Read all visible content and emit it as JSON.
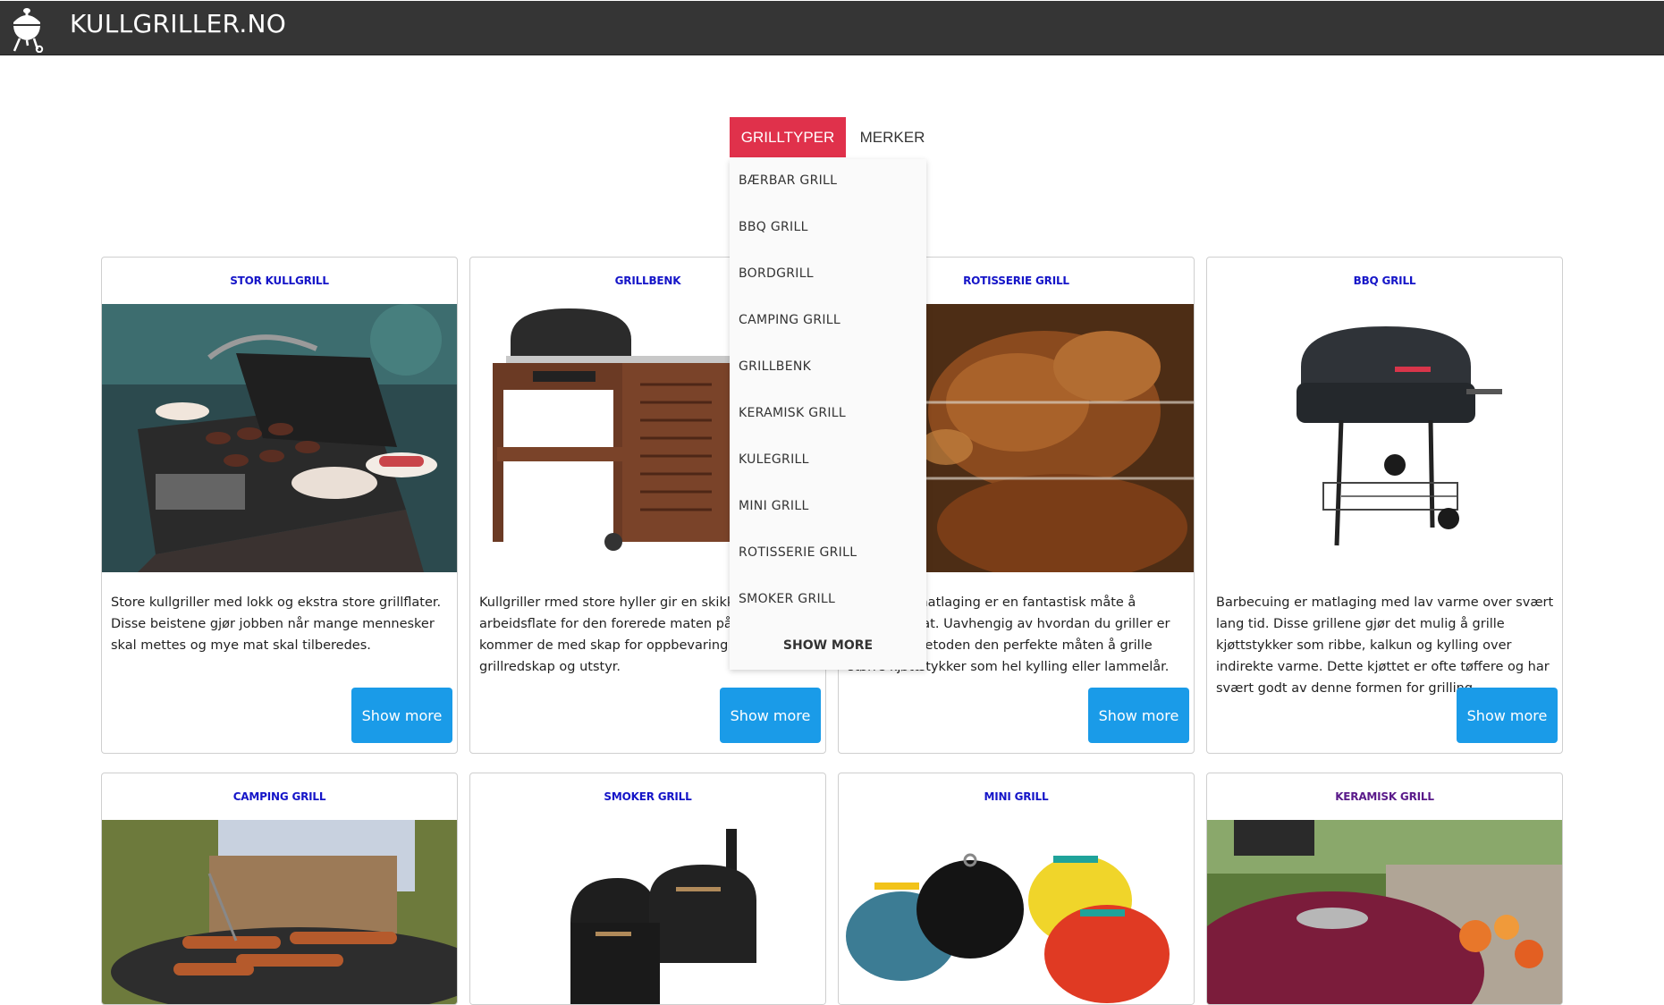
{
  "header": {
    "title": "KULLGRILLER.NO",
    "logo_icon": "kettle-grill-icon"
  },
  "tabs": [
    {
      "label": "GRILLTYPER",
      "active": true
    },
    {
      "label": "MERKER",
      "active": false
    }
  ],
  "dropdown": {
    "items": [
      "BÆRBAR GRILL",
      "BBQ GRILL",
      "BORDGRILL",
      "CAMPING GRILL",
      "GRILLBENK",
      "KERAMISK GRILL",
      "KULEGRILL",
      "MINI GRILL",
      "ROTISSERIE GRILL",
      "SMOKER GRILL"
    ],
    "more_label": "SHOW MORE"
  },
  "cards": [
    {
      "title": "STOR KULLGRILL",
      "text": "Store kullgriller med lokk og ekstra store grillflater. Disse beistene gjør jobben når mange mennesker skal mettes og mye mat skal tilberedes.",
      "button": "Show more"
    },
    {
      "title": "GRILLBENK",
      "text": "Kullgriller rmed store hyller gir en skikkelig arbeidsflate for den forerede maten på. I tillegg kommer de med skap for oppbevaring av grillredskap og utstyr.",
      "button": "Show more"
    },
    {
      "title": "ROTISSERIE GRILL",
      "text": "Rotisserie matlaging er en fantastisk måte å tilberede mat. Uavhengig av hvordan du griller er rotisserie-metoden den perfekte måten å grille større kjøttstykker som hel kylling eller lammelår.",
      "button": "Show more"
    },
    {
      "title": "BBQ GRILL",
      "text": "Barbecuing er matlaging med lav varme over svært lang tid. Disse grillene gjør det mulig å grille kjøttstykker som ribbe, kalkun og kylling over indirekte varme. Dette kjøttet er ofte tøffere og har svært godt av denne formen for grilling.",
      "button": "Show more"
    },
    {
      "title": "CAMPING GRILL"
    },
    {
      "title": "SMOKER GRILL"
    },
    {
      "title": "MINI GRILL"
    },
    {
      "title": "KERAMISK GRILL"
    }
  ],
  "colors": {
    "header_bg": "#353535",
    "tab_active": "#e0314b",
    "button": "#1a9be8",
    "link": "#1515c8",
    "link_visited": "#5a1a8a"
  }
}
